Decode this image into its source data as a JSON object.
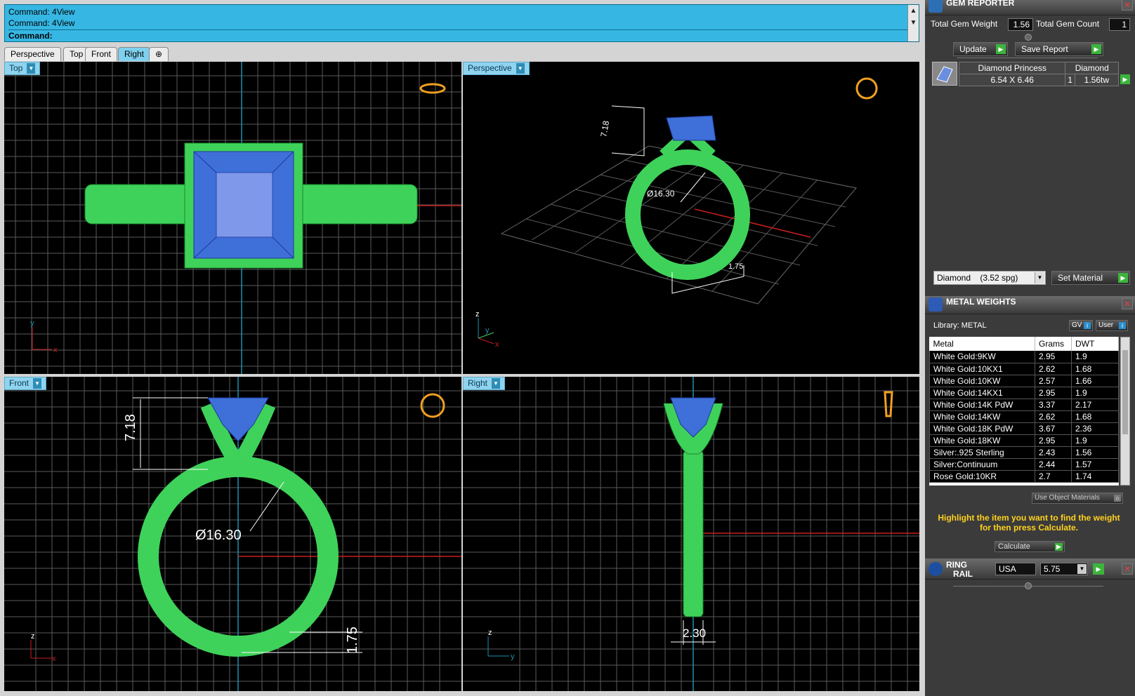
{
  "command": {
    "history": [
      "Command: 4View",
      "Command: 4View"
    ],
    "prompt": "Command:",
    "scroll_up": "▲",
    "scroll_down": "▼"
  },
  "tabs": [
    {
      "label": "Perspective",
      "active": false
    },
    {
      "label": "Top",
      "active": false
    },
    {
      "label": "Front",
      "active": false
    },
    {
      "label": "Right",
      "active": true
    },
    {
      "label": "⊕",
      "active": false
    }
  ],
  "viewports": {
    "top": {
      "label": "Top",
      "axis_a": "y",
      "axis_b": "x"
    },
    "perspective": {
      "label": "Perspective",
      "axis_a": "z",
      "axis_b": "y",
      "axis_c": "x",
      "dim_height": "7.18",
      "dim_diameter": "Ø16.30",
      "dim_band": "1.75"
    },
    "front": {
      "label": "Front",
      "axis_a": "z",
      "axis_b": "x",
      "dim_height": "7.18",
      "dim_diameter": "Ø16.30",
      "dim_band": "1.75"
    },
    "right": {
      "label": "Right",
      "axis_a": "z",
      "axis_b": "y",
      "dim_width": "2.30"
    }
  },
  "gem_reporter": {
    "title": "GEM REPORTER",
    "total_weight_label": "Total Gem Weight",
    "total_weight_value": "1.56",
    "total_count_label": "Total Gem Count",
    "total_count_value": "1",
    "update_label": "Update",
    "save_report_label": "Save Report",
    "gems": [
      {
        "name": "Diamond Princess",
        "size": "6.54 X 6.46",
        "material": "Diamond",
        "count": "1",
        "weight": "1.56tw"
      }
    ],
    "material_select": "Diamond    (3.52 spg)",
    "set_material_label": "Set Material"
  },
  "metal_weights": {
    "title": "METAL WEIGHTS",
    "library_label": "Library: METAL",
    "gv_label": "GV",
    "user_label": "User",
    "columns": [
      "Metal",
      "Grams",
      "DWT"
    ],
    "rows": [
      [
        "White Gold:9KW",
        "2.95",
        "1.9"
      ],
      [
        "White Gold:10KX1",
        "2.62",
        "1.68"
      ],
      [
        "White Gold:10KW",
        "2.57",
        "1.66"
      ],
      [
        "White Gold:14KX1",
        "2.95",
        "1.9"
      ],
      [
        "White Gold:14K PdW",
        "3.37",
        "2.17"
      ],
      [
        "White Gold:14KW",
        "2.62",
        "1.68"
      ],
      [
        "White Gold:18K PdW",
        "3.67",
        "2.36"
      ],
      [
        "White Gold:18KW",
        "2.95",
        "1.9"
      ],
      [
        "Silver:.925 Sterling",
        "2.43",
        "1.56"
      ],
      [
        "Silver:Continuum",
        "2.44",
        "1.57"
      ],
      [
        "Rose Gold:10KR",
        "2.7",
        "1.74"
      ]
    ],
    "use_object_materials": "Use Object Materials",
    "hint": "Highlight the item you want to find the weight for then press Calculate.",
    "calculate_label": "Calculate"
  },
  "ring_rail": {
    "title_line1": "RING",
    "title_line2": "RAIL",
    "region": "USA",
    "size": "5.75"
  },
  "colors": {
    "command_bg": "#36b7e3",
    "ring_green": "#3fd25a",
    "gem_blue": "#3f6fd8",
    "grid": "#5a5a5a",
    "axis_red": "#c81e1e",
    "axis_cyan": "#1d8fb0",
    "icon_gold": "#f0a020"
  }
}
